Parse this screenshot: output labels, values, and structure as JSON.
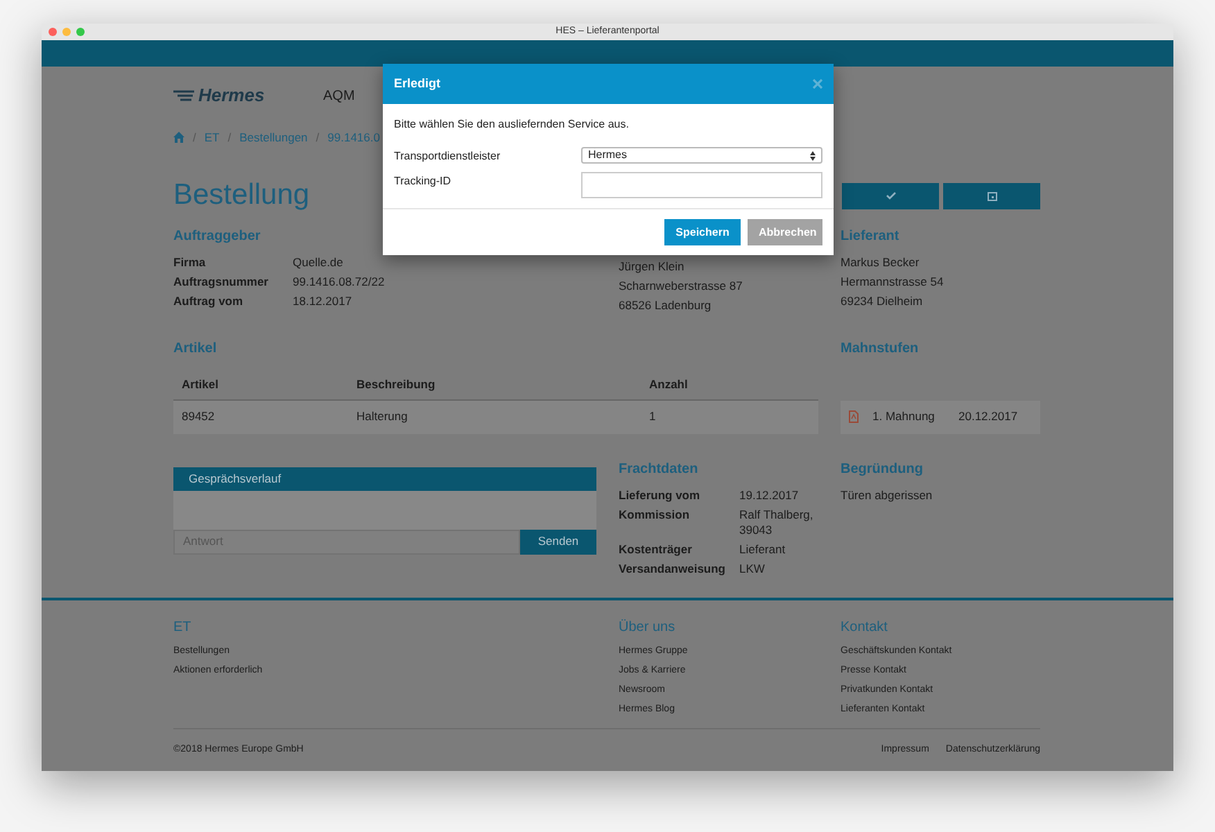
{
  "window": {
    "title": "HES – Lieferantenportal"
  },
  "header": {
    "logo": "Hermes",
    "nav": "AQM"
  },
  "breadcrumb": {
    "separator": "/",
    "items": [
      "ET",
      "Bestellungen",
      "99.1416.0"
    ]
  },
  "page_title": "Bestellung",
  "auftraggeber": {
    "heading": "Auftraggeber",
    "fields": [
      {
        "label": "Firma",
        "value": "Quelle.de"
      },
      {
        "label": "Auftragsnummer",
        "value": "99.1416.08.72/22"
      },
      {
        "label": "Auftrag vom",
        "value": "18.12.2017"
      }
    ]
  },
  "recipient": {
    "lines": [
      "Jürgen Klein",
      "Scharnweberstrasse 87",
      "68526 Ladenburg"
    ]
  },
  "lieferant": {
    "heading": "Lieferant",
    "lines": [
      "Markus Becker",
      "Hermannstrasse 54",
      "69234 Dielheim"
    ]
  },
  "artikel": {
    "heading": "Artikel",
    "columns": [
      "Artikel",
      "Beschreibung",
      "Anzahl"
    ],
    "rows": [
      [
        "89452",
        "Halterung",
        "1"
      ]
    ]
  },
  "mahnstufen": {
    "heading": "Mahnstufen",
    "items": [
      {
        "label": "1. Mahnung",
        "date": "20.12.2017"
      }
    ]
  },
  "chat": {
    "title": "Gesprächsverlauf",
    "placeholder": "Antwort",
    "button": "Senden"
  },
  "frachtdaten": {
    "heading": "Frachtdaten",
    "fields": [
      {
        "label": "Lieferung vom",
        "value": "19.12.2017"
      },
      {
        "label": "Kommission",
        "value": "Ralf Thalberg, 39043"
      },
      {
        "label": "Kostenträger",
        "value": "Lieferant"
      },
      {
        "label": "Versandanweisung",
        "value": "LKW"
      }
    ]
  },
  "begruendung": {
    "heading": "Begründung",
    "text": "Türen abgerissen"
  },
  "footer": {
    "columns": [
      {
        "heading": "ET",
        "links": [
          "Bestellungen",
          "Aktionen erforderlich"
        ]
      },
      {
        "heading": "Über uns",
        "links": [
          "Hermes Gruppe",
          "Jobs & Karriere",
          "Newsroom",
          "Hermes Blog"
        ]
      },
      {
        "heading": "Kontakt",
        "links": [
          "Geschäftskunden Kontakt",
          "Presse Kontakt",
          "Privatkunden Kontakt",
          "Lieferanten Kontakt"
        ]
      }
    ],
    "copyright": "©2018 Hermes Europe GmbH",
    "links": [
      "Impressum",
      "Datenschutzerklärung"
    ]
  },
  "modal": {
    "title": "Erledigt",
    "text": "Bitte wählen Sie den ausliefernden Service aus.",
    "fields": [
      {
        "label": "Transportdienstleister",
        "kind": "select",
        "value": "Hermes"
      },
      {
        "label": "Tracking-ID",
        "kind": "text"
      }
    ],
    "buttons": [
      {
        "label": "Speichern",
        "kind": "primary"
      },
      {
        "label": "Abbrechen",
        "kind": "secondary"
      }
    ]
  }
}
